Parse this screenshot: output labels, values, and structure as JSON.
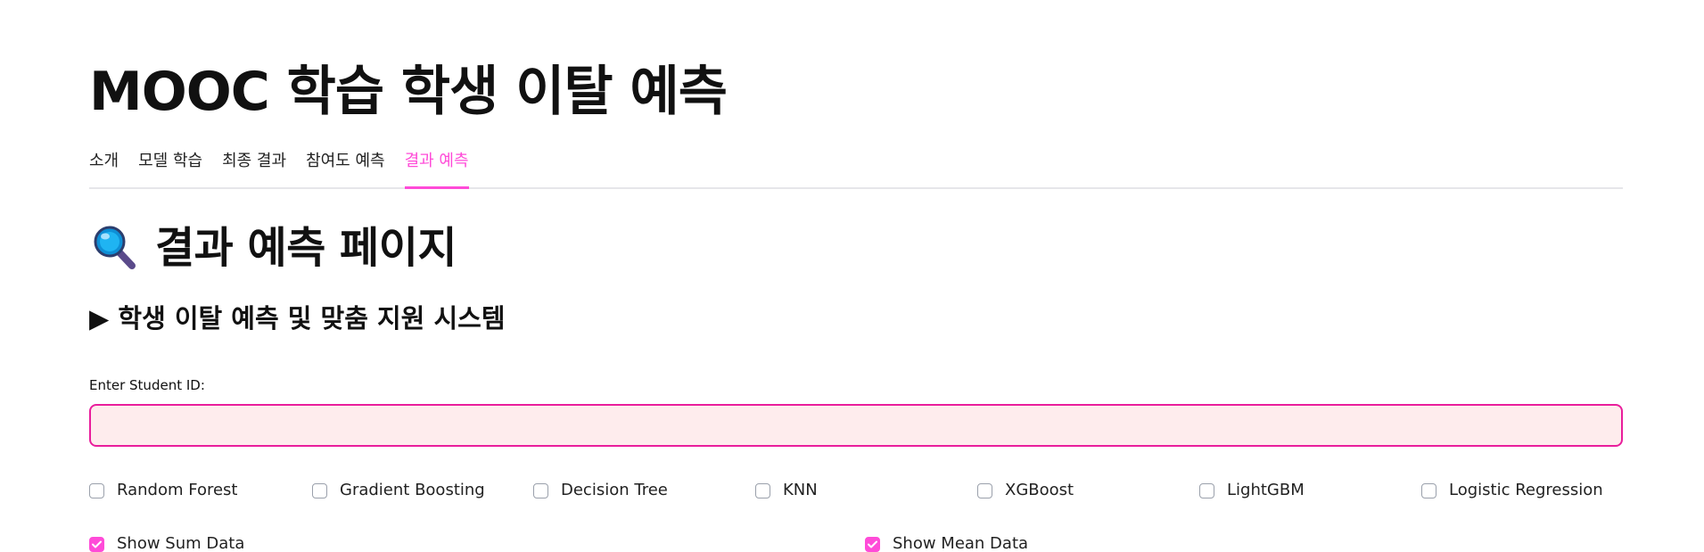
{
  "app": {
    "title": "MOOC 학습 학생 이탈 예측"
  },
  "tabs": [
    {
      "label": "소개",
      "active": false
    },
    {
      "label": "모델 학습",
      "active": false
    },
    {
      "label": "최종 결과",
      "active": false
    },
    {
      "label": "참여도 예측",
      "active": false
    },
    {
      "label": "결과 예측",
      "active": true
    }
  ],
  "page": {
    "heading_icon": "magnifying-glass-icon",
    "heading": "결과 예측 페이지",
    "subheading": "▶ 학생 이탈 예측 및 맞춤 지원 시스템"
  },
  "student_input": {
    "label": "Enter Student ID:",
    "value": "",
    "placeholder": ""
  },
  "models": [
    {
      "label": "Random Forest",
      "checked": false
    },
    {
      "label": "Gradient Boosting",
      "checked": false
    },
    {
      "label": "Decision Tree",
      "checked": false
    },
    {
      "label": "KNN",
      "checked": false
    },
    {
      "label": "XGBoost",
      "checked": false
    },
    {
      "label": "LightGBM",
      "checked": false
    },
    {
      "label": "Logistic Regression",
      "checked": false
    }
  ],
  "options": [
    {
      "label": "Show Sum Data",
      "checked": true
    },
    {
      "label": "Show Mean Data",
      "checked": true
    }
  ],
  "colors": {
    "accent": "#ff4bd8",
    "input_border": "#e91e9c",
    "input_background": "#feeced"
  }
}
